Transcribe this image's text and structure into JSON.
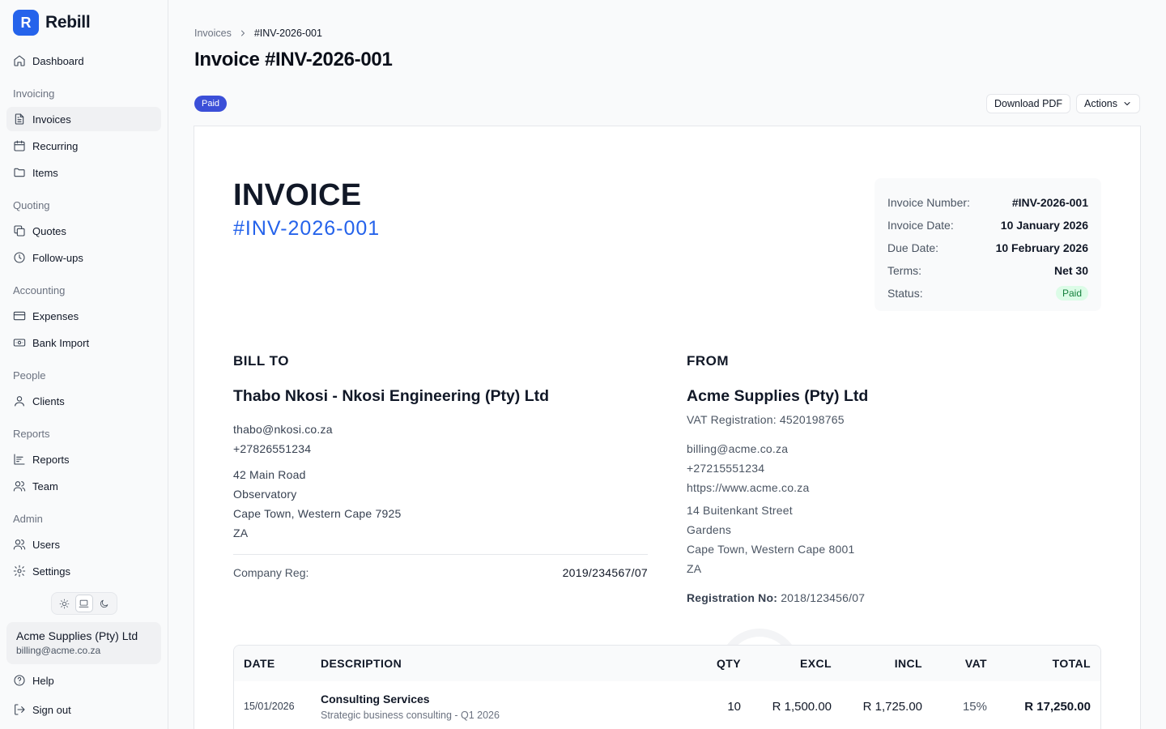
{
  "app": {
    "name": "Rebill",
    "logo_letter": "R"
  },
  "sidebar": {
    "dashboard": "Dashboard",
    "sections": {
      "invoicing": "Invoicing",
      "quoting": "Quoting",
      "accounting": "Accounting",
      "people": "People",
      "reports": "Reports",
      "admin": "Admin"
    },
    "items": {
      "invoices": "Invoices",
      "recurring": "Recurring",
      "items": "Items",
      "quotes": "Quotes",
      "followups": "Follow-ups",
      "expenses": "Expenses",
      "bank_import": "Bank Import",
      "clients": "Clients",
      "reports": "Reports",
      "team": "Team",
      "users": "Users",
      "settings": "Settings"
    },
    "org": {
      "name": "Acme Supplies (Pty) Ltd",
      "email": "billing@acme.co.za"
    },
    "help": "Help",
    "sign_out": "Sign out"
  },
  "breadcrumb": {
    "parent": "Invoices",
    "current": "#INV-2026-001"
  },
  "page": {
    "title": "Invoice #INV-2026-001",
    "status": "Paid",
    "download_label": "Download PDF",
    "actions_label": "Actions"
  },
  "invoice": {
    "heading": "INVOICE",
    "number": "#INV-2026-001",
    "meta": {
      "number_label": "Invoice Number:",
      "number_value": "#INV-2026-001",
      "date_label": "Invoice Date:",
      "date_value": "10 January 2026",
      "due_label": "Due Date:",
      "due_value": "10 February 2026",
      "terms_label": "Terms:",
      "terms_value": "Net 30",
      "status_label": "Status:",
      "status_value": "Paid"
    },
    "bill_to": {
      "title": "BILL TO",
      "name": "Thabo Nkosi - Nkosi Engineering (Pty) Ltd",
      "email": "thabo@nkosi.co.za",
      "phone": "+27826551234",
      "address1": "42 Main Road",
      "address2": "Observatory",
      "address3": "Cape Town, Western Cape 7925",
      "country": "ZA",
      "reg_label": "Company Reg:",
      "reg_value": "2019/234567/07"
    },
    "from": {
      "title": "FROM",
      "name": "Acme Supplies (Pty) Ltd",
      "vat": "VAT Registration: 4520198765",
      "email": "billing@acme.co.za",
      "phone": "+27215551234",
      "website": "https://www.acme.co.za",
      "address1": "14 Buitenkant Street",
      "address2": "Gardens",
      "address3": "Cape Town, Western Cape 8001",
      "country": "ZA",
      "reg_label": "Registration No:",
      "reg_value": "2018/123456/07"
    },
    "table": {
      "headers": {
        "date": "DATE",
        "description": "DESCRIPTION",
        "qty": "QTY",
        "excl": "EXCL",
        "incl": "INCL",
        "vat": "VAT",
        "total": "TOTAL"
      },
      "rows": [
        {
          "date": "15/01/2026",
          "title": "Consulting Services",
          "subtitle": "Strategic business consulting - Q1 2026",
          "qty": "10",
          "excl": "R 1,500.00",
          "incl": "R 1,725.00",
          "vat": "15%",
          "total": "R 17,250.00"
        }
      ]
    }
  }
}
